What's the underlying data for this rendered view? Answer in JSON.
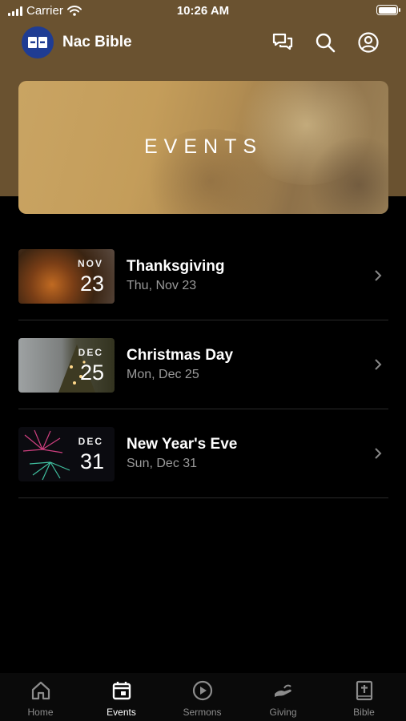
{
  "status_bar": {
    "carrier": "Carrier",
    "time": "10:26 AM"
  },
  "header": {
    "app_title": "Nac Bible"
  },
  "hero": {
    "title": "EVENTS"
  },
  "events": [
    {
      "month": "NOV",
      "day": "23",
      "title": "Thanksgiving",
      "date": "Thu, Nov 23"
    },
    {
      "month": "DEC",
      "day": "25",
      "title": "Christmas Day",
      "date": "Mon, Dec 25"
    },
    {
      "month": "DEC",
      "day": "31",
      "title": "New Year's Eve",
      "date": "Sun, Dec 31"
    }
  ],
  "tabs": [
    {
      "label": "Home",
      "icon": "home-icon"
    },
    {
      "label": "Events",
      "icon": "calendar-icon"
    },
    {
      "label": "Sermons",
      "icon": "play-circle-icon"
    },
    {
      "label": "Giving",
      "icon": "giving-hand-icon"
    },
    {
      "label": "Bible",
      "icon": "bible-icon"
    }
  ],
  "active_tab": "Events",
  "colors": {
    "header_bg": "#6a5230",
    "logo_bg": "#1f3c93",
    "background": "#000000",
    "inactive_tab": "#8c8c8c"
  }
}
